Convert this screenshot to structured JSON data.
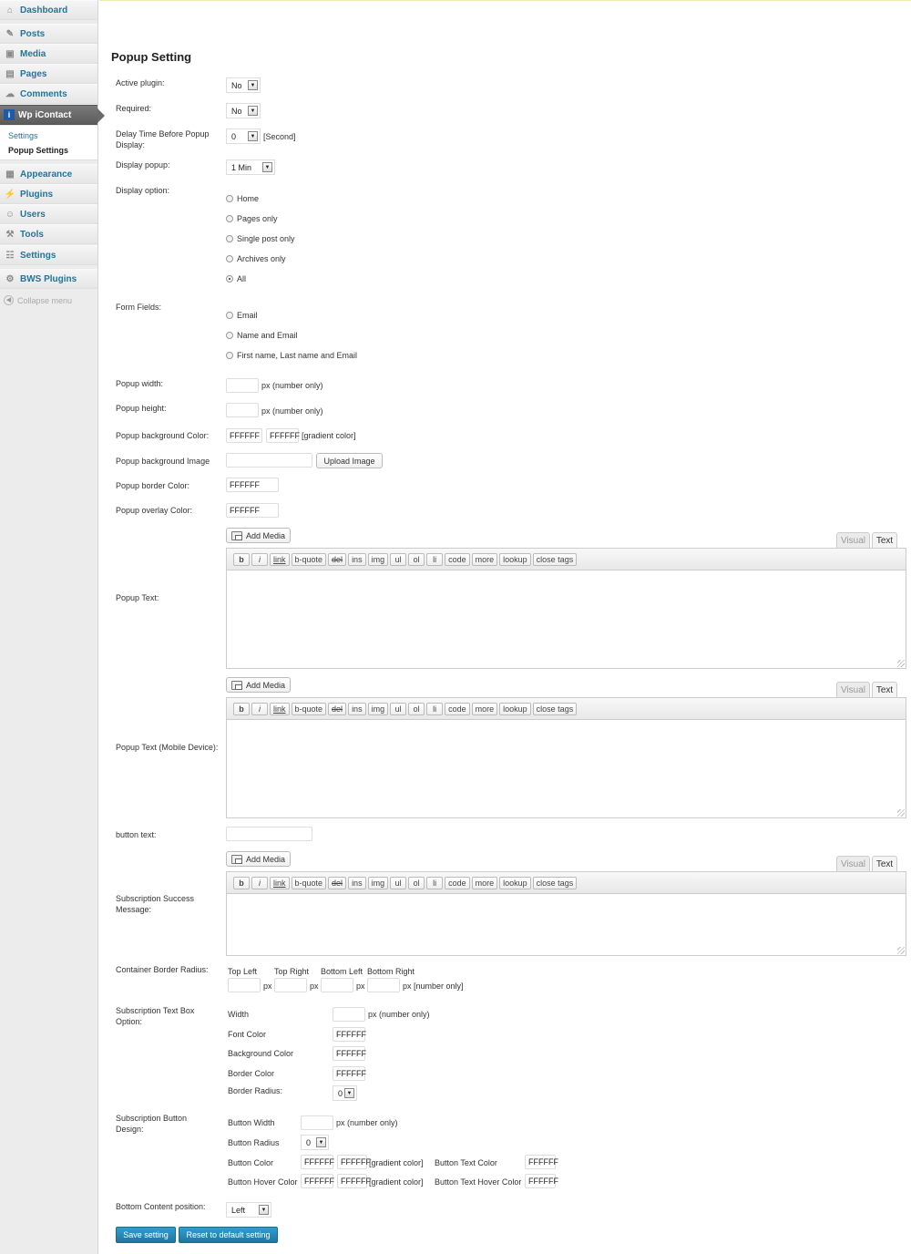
{
  "sidebar": {
    "items": [
      {
        "label": "Dashboard",
        "icon": "dashboard-icon"
      },
      {
        "label": "Posts",
        "icon": "pin-icon"
      },
      {
        "label": "Media",
        "icon": "media-icon"
      },
      {
        "label": "Pages",
        "icon": "pages-icon"
      },
      {
        "label": "Comments",
        "icon": "comments-icon"
      },
      {
        "label": "Wp iContact",
        "icon": "icontact-icon"
      },
      {
        "label": "Appearance",
        "icon": "appearance-icon"
      },
      {
        "label": "Plugins",
        "icon": "plugins-icon"
      },
      {
        "label": "Users",
        "icon": "users-icon"
      },
      {
        "label": "Tools",
        "icon": "tools-icon"
      },
      {
        "label": "Settings",
        "icon": "settings-icon"
      },
      {
        "label": "BWS Plugins",
        "icon": "bws-icon"
      }
    ],
    "submenu": [
      {
        "label": "Settings"
      },
      {
        "label": "Popup Settings"
      }
    ],
    "collapse": "Collapse menu"
  },
  "page": {
    "title": "Popup Setting"
  },
  "form": {
    "active_plugin": {
      "label": "Active plugin:",
      "value": "No"
    },
    "required": {
      "label": "Required:",
      "value": "No"
    },
    "delay": {
      "label": "Delay Time Before Popup Display:",
      "value": "0",
      "unit": "[Second]"
    },
    "display_popup": {
      "label": "Display popup:",
      "value": "1 Min"
    },
    "display_option": {
      "label": "Display option:",
      "options": [
        "Home",
        "Pages only",
        "Single post only",
        "Archives only",
        "All"
      ],
      "selected": "All"
    },
    "form_fields": {
      "label": "Form Fields:",
      "options": [
        "Email",
        "Name and Email",
        "First name, Last name and Email"
      ]
    },
    "popup_width": {
      "label": "Popup width:",
      "value": "",
      "unit": "px (number only)"
    },
    "popup_height": {
      "label": "Popup height:",
      "value": "",
      "unit": "px (number only)"
    },
    "bg_color": {
      "label": "Popup background Color:",
      "value1": "FFFFFF",
      "value2": "FFFFFF",
      "note": "[gradient color]"
    },
    "bg_image": {
      "label": "Popup background Image",
      "value": "",
      "button": "Upload Image"
    },
    "border_color": {
      "label": "Popup border Color:",
      "value": "FFFFFF"
    },
    "overlay_color": {
      "label": "Popup overlay Color:",
      "value": "FFFFFF"
    },
    "popup_text": {
      "label": "Popup Text:"
    },
    "popup_text_mobile": {
      "label": "Popup Text (Mobile Device):"
    },
    "button_text": {
      "label": "button text:",
      "value": ""
    },
    "success_msg": {
      "label": "Subscription Success Message:"
    },
    "radius": {
      "label": "Container Border Radius:",
      "corners": [
        "Top Left",
        "Top Right",
        "Bottom Left",
        "Bottom Right"
      ],
      "unit": "px",
      "unit_last": "px [number only]"
    },
    "textbox": {
      "label": "Subscription Text Box Option:",
      "width_label": "Width",
      "width_unit": "px (number only)",
      "font_color_label": "Font Color",
      "font_color": "FFFFFF",
      "bg_color_label": "Background Color",
      "bg_color": "FFFFFF",
      "border_color_label": "Border Color",
      "border_color": "FFFFFF",
      "border_radius_label": "Border Radius:",
      "border_radius": "0"
    },
    "button_design": {
      "label": "Subscription Button Design:",
      "width_label": "Button Width",
      "width_unit": "px (number only)",
      "radius_label": "Button Radius",
      "radius": "0",
      "color_label": "Button Color",
      "color1": "FFFFFF",
      "color2": "FFFFFF",
      "gradient_note": "[gradient color]",
      "text_color_label": "Button Text Color",
      "text_color": "FFFFFF",
      "hover_label": "Button Hover Color",
      "hover1": "FFFFFF",
      "hover2": "FFFFFF",
      "hover_text_label": "Button Text Hover Color",
      "hover_text": "FFFFFF"
    },
    "bottom_position": {
      "label": "Bottom Content position:",
      "value": "Left"
    }
  },
  "editor": {
    "add_media": "Add Media",
    "tab_visual": "Visual",
    "tab_text": "Text",
    "buttons": [
      "b",
      "i",
      "link",
      "b-quote",
      "del",
      "ins",
      "img",
      "ul",
      "ol",
      "li",
      "code",
      "more",
      "lookup",
      "close tags"
    ]
  },
  "actions": {
    "save": "Save setting",
    "reset": "Reset to default setting"
  }
}
